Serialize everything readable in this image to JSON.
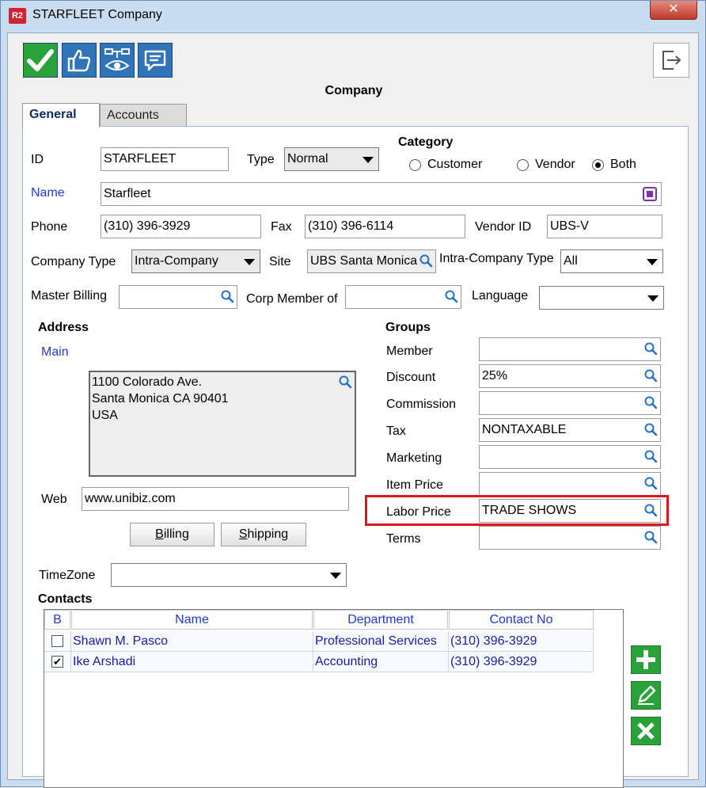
{
  "window": {
    "title": "STARFLEET Company",
    "app_badge": "R2",
    "close_glyph": "✕"
  },
  "toolbar": {
    "buttons": [
      {
        "icon": "checkmark-icon",
        "color": "#2aa23a"
      },
      {
        "icon": "thumbs-up-icon",
        "color": "#2f73b8"
      },
      {
        "icon": "workflow-view-icon",
        "color": "#2f73b8"
      },
      {
        "icon": "comment-icon",
        "color": "#2f73b8"
      }
    ],
    "exit_icon": "exit-icon"
  },
  "form": {
    "title": "Company"
  },
  "tabs": [
    {
      "label": "General",
      "active": true
    },
    {
      "label": "Accounts",
      "active": false
    }
  ],
  "general": {
    "id": {
      "label": "ID",
      "value": "STARFLEET"
    },
    "type": {
      "label": "Type",
      "value": "Normal"
    },
    "category": {
      "label": "Category",
      "options": [
        {
          "label": "Customer",
          "checked": false
        },
        {
          "label": "Vendor",
          "checked": false
        },
        {
          "label": "Both",
          "checked": true
        }
      ]
    },
    "name": {
      "label": "Name",
      "value": "Starfleet"
    },
    "phone": {
      "label": "Phone",
      "value": "(310) 396-3929"
    },
    "fax": {
      "label": "Fax",
      "value": "(310) 396-6114"
    },
    "vendor_id": {
      "label": "Vendor ID",
      "value": "UBS-V"
    },
    "company_type": {
      "label": "Company Type",
      "value": "Intra-Company"
    },
    "site": {
      "label": "Site",
      "value": "UBS Santa Monica"
    },
    "intra_company_type": {
      "label": "Intra-Company Type",
      "value": "All"
    },
    "master_billing": {
      "label": "Master Billing",
      "value": ""
    },
    "corp_member_of": {
      "label": "Corp Member of",
      "value": ""
    },
    "language": {
      "label": "Language",
      "value": ""
    },
    "address": {
      "label": "Address",
      "main_label": "Main",
      "lines": [
        "1100 Colorado Ave.",
        "Santa Monica CA 90401",
        "USA"
      ]
    },
    "web": {
      "label": "Web",
      "value": "www.unibiz.com"
    },
    "billing_button": {
      "first": "B",
      "rest": "illing"
    },
    "shipping_button": {
      "first": "S",
      "rest": "hipping"
    },
    "timezone": {
      "label": "TimeZone",
      "value": ""
    },
    "groups": {
      "label": "Groups",
      "member": {
        "label": "Member",
        "value": ""
      },
      "discount": {
        "label": "Discount",
        "value": "25%"
      },
      "commission": {
        "label": "Commission",
        "value": ""
      },
      "tax": {
        "label": "Tax",
        "value": "NONTAXABLE"
      },
      "marketing": {
        "label": "Marketing",
        "value": ""
      },
      "item_price": {
        "label": "Item Price",
        "value": ""
      },
      "labor_price": {
        "label": "Labor Price",
        "value": "TRADE SHOWS"
      },
      "terms": {
        "label": "Terms",
        "value": ""
      }
    },
    "highlight_color": "#e0161e"
  },
  "contacts": {
    "label": "Contacts",
    "columns": [
      "B",
      "Name",
      "Department",
      "Contact No"
    ],
    "rows": [
      {
        "checked": false,
        "check_glyph": "",
        "name": "Shawn M. Pasco",
        "department": "Professional Services",
        "contact_no": "(310) 396-3929"
      },
      {
        "checked": true,
        "check_glyph": "✔",
        "name": "Ike Arshadi",
        "department": "Accounting",
        "contact_no": "(310) 396-3929"
      }
    ],
    "actions": [
      "add-icon",
      "edit-icon",
      "delete-icon"
    ]
  }
}
